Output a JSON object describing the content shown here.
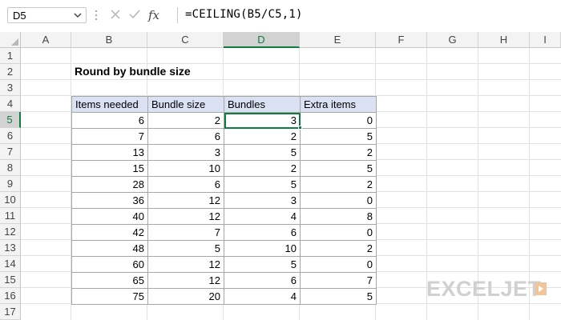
{
  "formula_bar": {
    "name_box": "D5",
    "formula": "=CEILING(B5/C5,1)"
  },
  "columns": [
    "A",
    "B",
    "C",
    "D",
    "E",
    "F",
    "G",
    "H",
    "I"
  ],
  "rows": [
    "1",
    "2",
    "3",
    "4",
    "5",
    "6",
    "7",
    "8",
    "9",
    "10",
    "11",
    "12",
    "13",
    "14",
    "15",
    "16",
    "17"
  ],
  "sheet": {
    "title": "Round by bundle size",
    "headers": [
      "Items needed",
      "Bundle size",
      "Bundles",
      "Extra items"
    ],
    "rows": [
      [
        "6",
        "2",
        "3",
        "0"
      ],
      [
        "7",
        "6",
        "2",
        "5"
      ],
      [
        "13",
        "3",
        "5",
        "2"
      ],
      [
        "15",
        "10",
        "2",
        "5"
      ],
      [
        "28",
        "6",
        "5",
        "2"
      ],
      [
        "36",
        "12",
        "3",
        "0"
      ],
      [
        "40",
        "12",
        "4",
        "8"
      ],
      [
        "42",
        "7",
        "6",
        "0"
      ],
      [
        "48",
        "5",
        "10",
        "2"
      ],
      [
        "60",
        "12",
        "5",
        "0"
      ],
      [
        "65",
        "12",
        "6",
        "7"
      ],
      [
        "75",
        "20",
        "4",
        "5"
      ]
    ]
  },
  "colors": {
    "accent": "#107c41",
    "header_fill": "#d9e1f2",
    "logo": "#d0d0d0",
    "logo_mark": "#f2c49a"
  },
  "logo": {
    "text": "EXCELJET"
  }
}
